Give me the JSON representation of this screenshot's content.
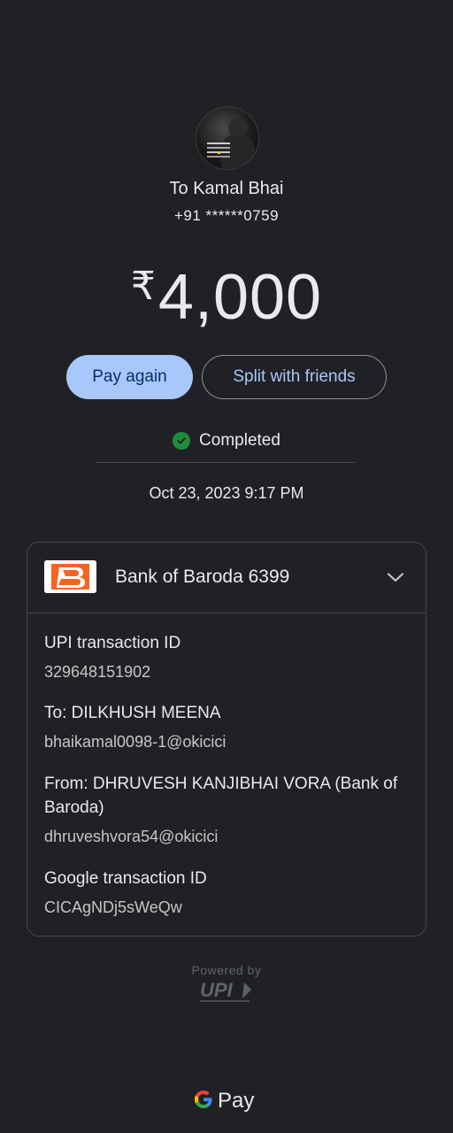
{
  "payee": {
    "name": "To Kamal Bhai",
    "phone": "+91 ******0759",
    "avatar_icon": "profile-photo"
  },
  "payment": {
    "currency_symbol": "₹",
    "amount": "4,000",
    "status": "Completed",
    "status_color": "#1e8e3e",
    "datetime": "Oct 23, 2023 9:17 PM"
  },
  "actions": {
    "pay_again": "Pay again",
    "split": "Split with friends"
  },
  "details": {
    "bank_label": "Bank of Baroda 6399",
    "upi_id_label": "UPI transaction ID",
    "upi_id_value": "329648151902",
    "to_label": "To: DILKHUSH  MEENA",
    "to_value": "bhaikamal0098-1@okicici",
    "from_label": "From: DHRUVESH KANJIBHAI VORA (Bank of Baroda)",
    "from_value": "dhruveshvora54@okicici",
    "google_id_label": "Google transaction ID",
    "google_id_value": "CICAgNDj5sWeQw"
  },
  "footer": {
    "powered_by": "Powered by",
    "upi_logo": "UPI",
    "gpay_label": "Pay"
  },
  "colors": {
    "background": "#202124",
    "primary_button": "#a8c7fa",
    "bank_brand": "#f26522"
  }
}
